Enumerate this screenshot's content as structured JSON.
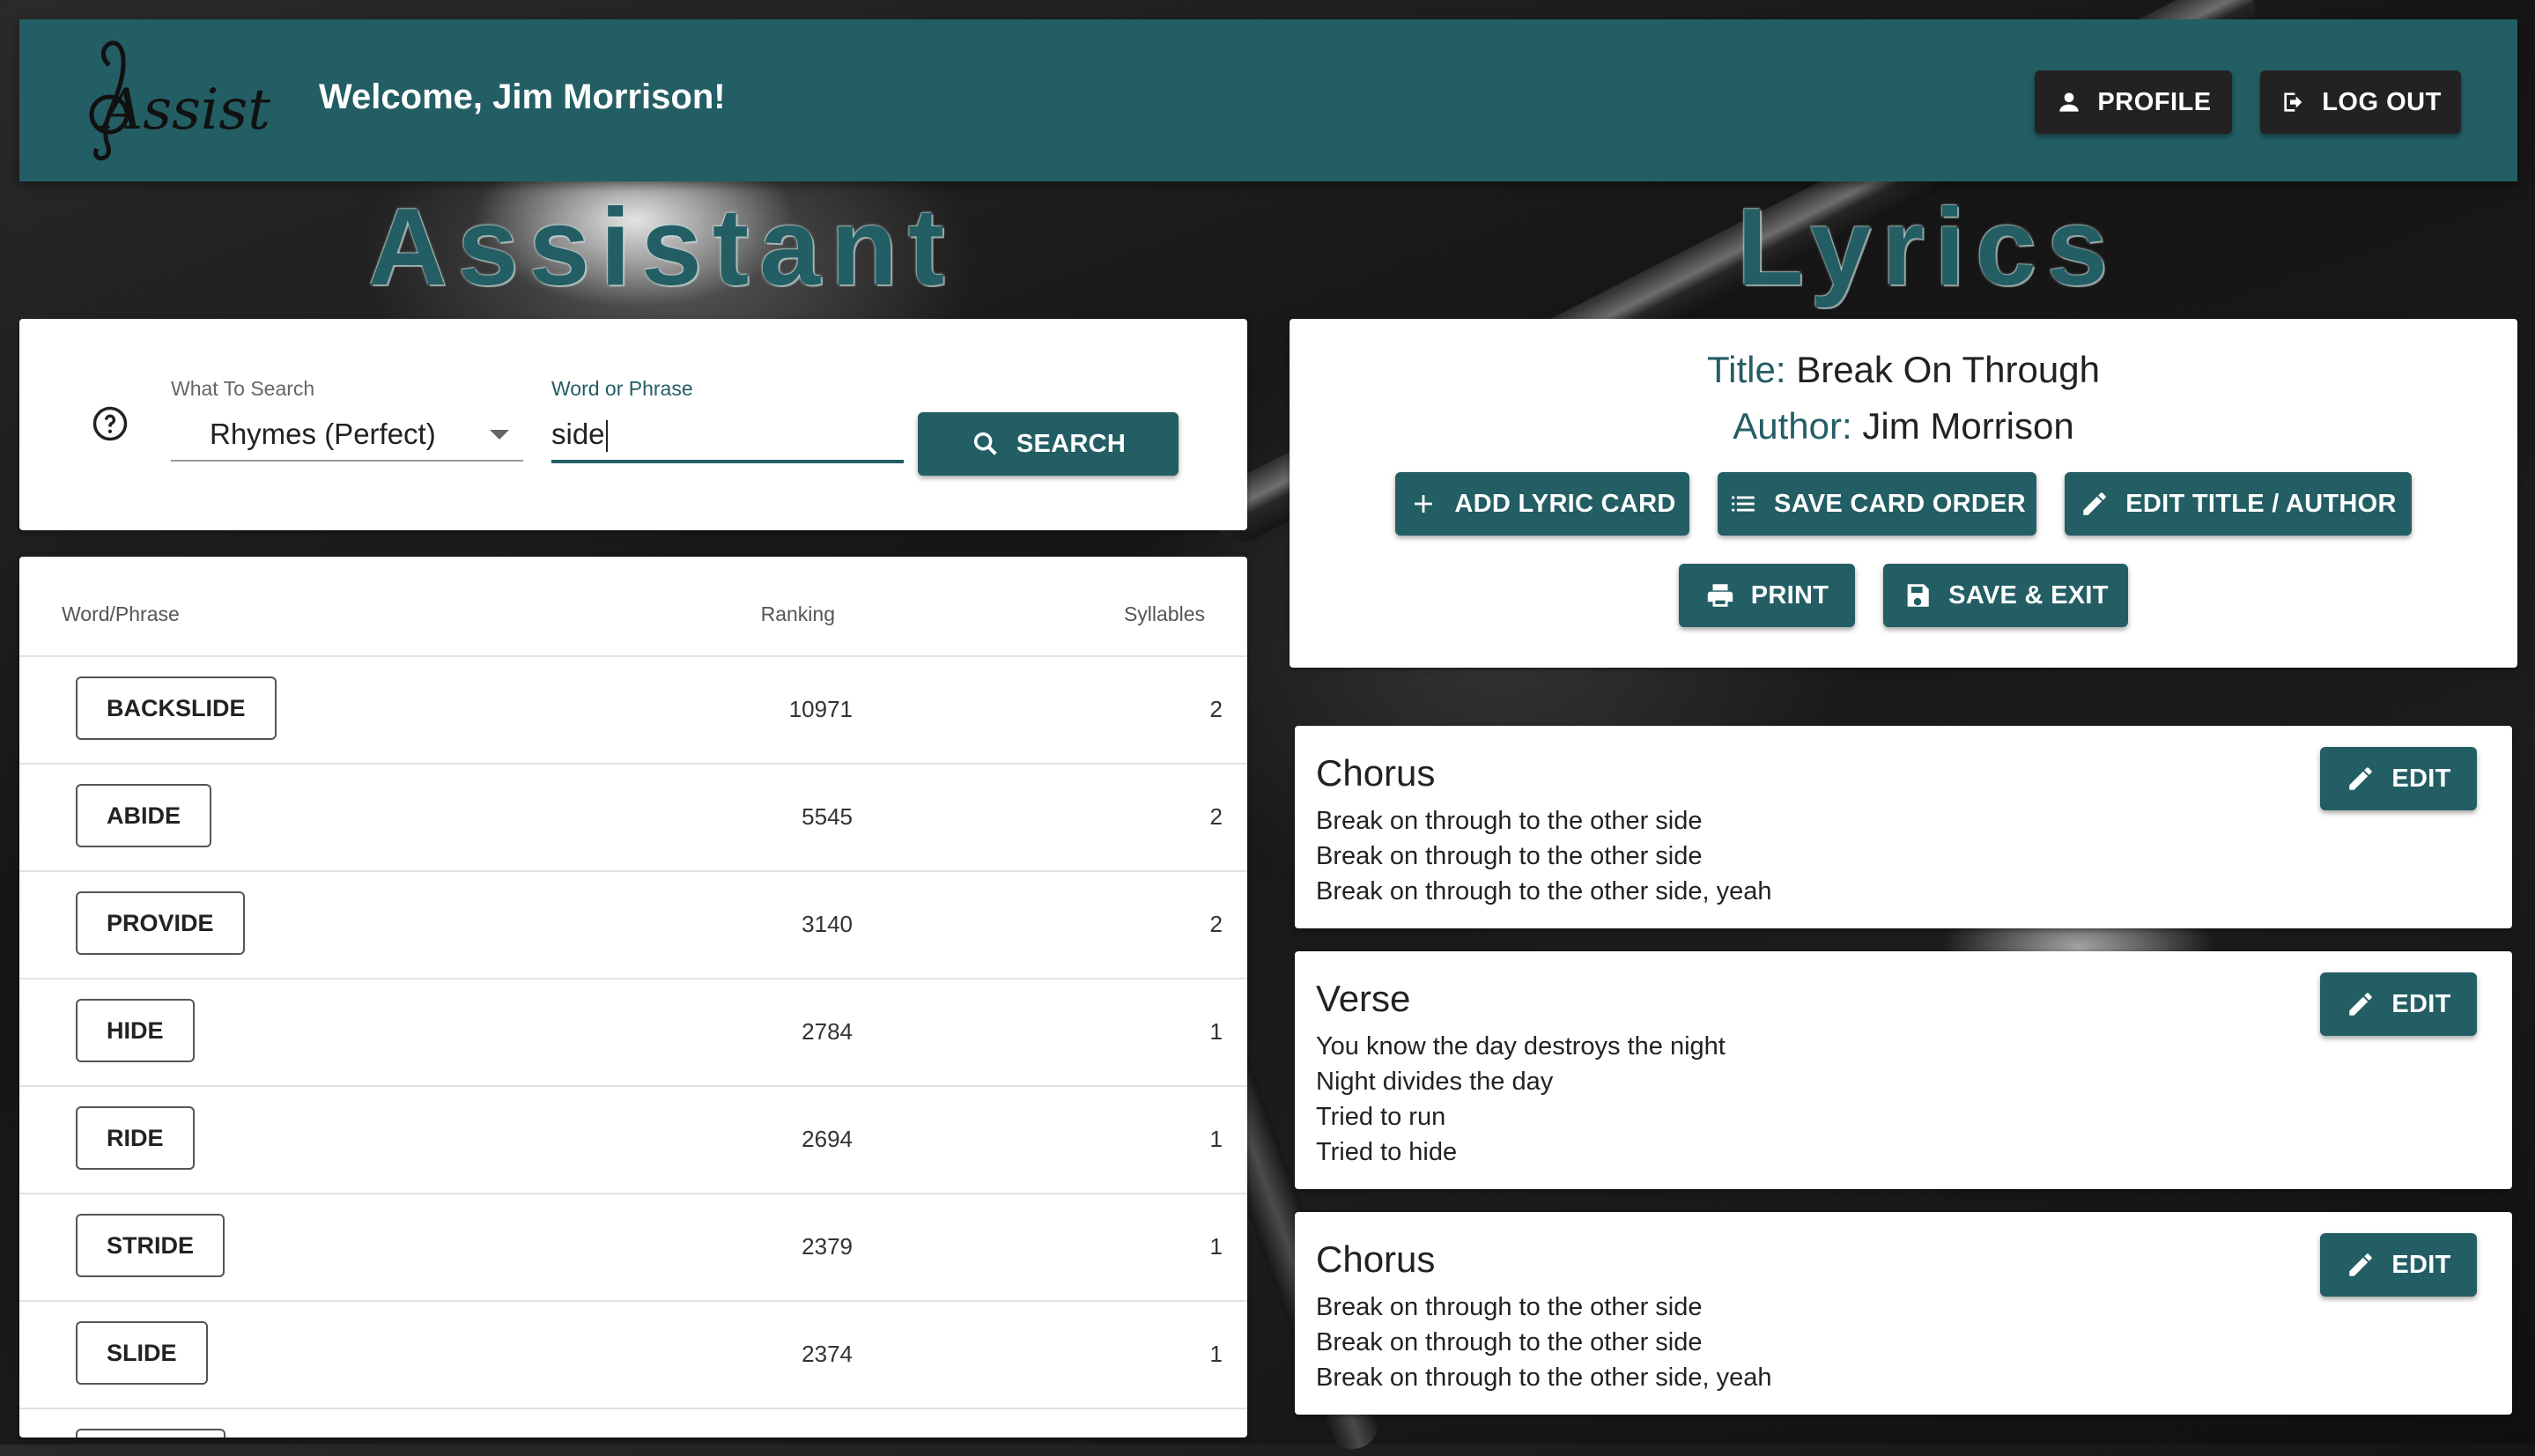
{
  "app": {
    "logo_text": "Assist",
    "welcome": "Welcome, Jim Morrison!"
  },
  "header": {
    "profile_label": "PROFILE",
    "logout_label": "LOG OUT",
    "profile_icon": "person-icon",
    "logout_icon": "logout-icon"
  },
  "headings": {
    "assistant": "Assistant",
    "lyrics": "Lyrics"
  },
  "search": {
    "what_label": "What To Search",
    "what_value": "Rhymes (Perfect)",
    "word_label": "Word or Phrase",
    "word_value": "side",
    "button_label": "SEARCH"
  },
  "results": {
    "columns": [
      "Word/Phrase",
      "Ranking",
      "Syllables"
    ],
    "rows": [
      {
        "word": "BACKSLIDE",
        "ranking": "10971",
        "syllables": "2"
      },
      {
        "word": "ABIDE",
        "ranking": "5545",
        "syllables": "2"
      },
      {
        "word": "PROVIDE",
        "ranking": "3140",
        "syllables": "2"
      },
      {
        "word": "HIDE",
        "ranking": "2784",
        "syllables": "1"
      },
      {
        "word": "RIDE",
        "ranking": "2694",
        "syllables": "1"
      },
      {
        "word": "STRIDE",
        "ranking": "2379",
        "syllables": "1"
      },
      {
        "word": "SLIDE",
        "ranking": "2374",
        "syllables": "1"
      }
    ]
  },
  "song": {
    "title_label": "Title:",
    "title": "Break On Through",
    "author_label": "Author:",
    "author": "Jim Morrison",
    "actions": {
      "add_card": "ADD LYRIC CARD",
      "save_order": "SAVE CARD ORDER",
      "edit_title": "EDIT TITLE / AUTHOR",
      "print": "PRINT",
      "save_exit": "SAVE & EXIT"
    }
  },
  "cards": [
    {
      "title": "Chorus",
      "edit": "EDIT",
      "lines": [
        "Break on through to the other side",
        "Break on through to the other side",
        "Break on through to the other side, yeah"
      ]
    },
    {
      "title": "Verse",
      "edit": "EDIT",
      "lines": [
        "You know the day destroys the night",
        "Night divides the day",
        "Tried to run",
        "Tried to hide"
      ]
    },
    {
      "title": "Chorus",
      "edit": "EDIT",
      "lines": [
        "Break on through to the other side",
        "Break on through to the other side",
        "Break on through to the other side, yeah"
      ]
    }
  ],
  "colors": {
    "brand": "#235e64",
    "dark_button": "#222222"
  }
}
